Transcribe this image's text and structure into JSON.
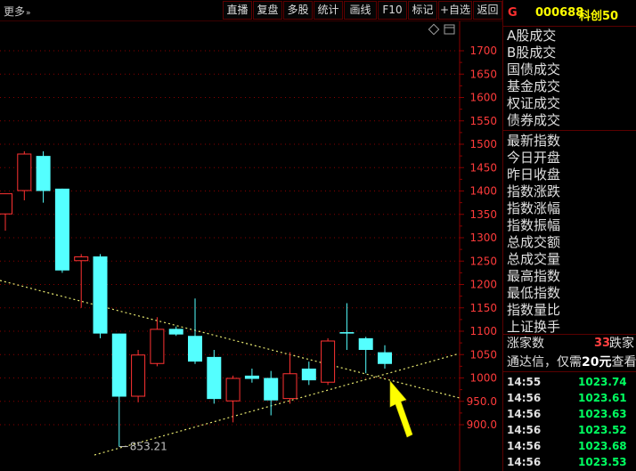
{
  "toolbar": {
    "more_label": "更多",
    "buttons": [
      "直播",
      "复盘",
      "多股",
      "统计",
      "画线",
      "F10",
      "标记",
      "+自选",
      "返回"
    ]
  },
  "chart_data": {
    "type": "candlestick",
    "y_ticks": [
      "1700",
      "1650",
      "1600",
      "1550",
      "1500",
      "1450",
      "1400",
      "1350",
      "1300",
      "1250",
      "1200",
      "1150",
      "1100",
      "1050",
      "1000",
      "950.0",
      "900.0"
    ],
    "ylim": [
      900,
      1700
    ],
    "low_annotation": "853.21",
    "candles": [
      {
        "o": 1350,
        "h": 1390,
        "l": 1315,
        "c": 1395
      },
      {
        "o": 1400,
        "h": 1485,
        "l": 1380,
        "c": 1480
      },
      {
        "o": 1475,
        "h": 1485,
        "l": 1375,
        "c": 1400
      },
      {
        "o": 1405,
        "h": 1405,
        "l": 1225,
        "c": 1230
      },
      {
        "o": 1250,
        "h": 1265,
        "l": 1150,
        "c": 1260
      },
      {
        "o": 1260,
        "h": 1265,
        "l": 1085,
        "c": 1095
      },
      {
        "o": 1095,
        "h": 1095,
        "l": 853.21,
        "c": 960
      },
      {
        "o": 960,
        "h": 1060,
        "l": 948,
        "c": 1050
      },
      {
        "o": 1030,
        "h": 1130,
        "l": 1025,
        "c": 1105
      },
      {
        "o": 1105,
        "h": 1110,
        "l": 1090,
        "c": 1093
      },
      {
        "o": 1090,
        "h": 1170,
        "l": 1030,
        "c": 1035
      },
      {
        "o": 1045,
        "h": 1060,
        "l": 945,
        "c": 955
      },
      {
        "o": 950,
        "h": 1005,
        "l": 905,
        "c": 1000
      },
      {
        "o": 1005,
        "h": 1020,
        "l": 990,
        "c": 998
      },
      {
        "o": 1000,
        "h": 1015,
        "l": 920,
        "c": 952
      },
      {
        "o": 955,
        "h": 1055,
        "l": 945,
        "c": 1010
      },
      {
        "o": 1020,
        "h": 1035,
        "l": 985,
        "c": 995
      },
      {
        "o": 990,
        "h": 1085,
        "l": 985,
        "c": 1080
      },
      {
        "o": 1098,
        "h": 1160,
        "l": 1060,
        "c": 1095
      },
      {
        "o": 1085,
        "h": 1088,
        "l": 1010,
        "c": 1060
      },
      {
        "o": 1055,
        "h": 1070,
        "l": 1020,
        "c": 1030
      }
    ],
    "colors": {
      "up": "#ff3232",
      "down": "#54ffff",
      "trend": "#e8e870",
      "arrow": "#ffff00",
      "grid": "#8a0000"
    }
  },
  "right_panel": {
    "flag": "G",
    "code": "000688",
    "name": "科创50",
    "group1": [
      "A股成交",
      "B股成交",
      "国债成交",
      "基金成交",
      "权证成交",
      "债券成交"
    ],
    "group2": [
      "最新指数",
      "今日开盘",
      "昨日收盘",
      "指数涨跌",
      "指数涨幅",
      "指数振幅",
      "总成交额",
      "总成交量",
      "最高指数",
      "最低指数",
      "指数量比",
      "上证换手"
    ],
    "advancers_label": "涨家数",
    "advancers_count": "33",
    "decliners_label": "跌家",
    "promo_prefix": "通达信，仅需",
    "promo_price": "20元",
    "promo_suffix": "查看",
    "ticks": [
      {
        "time": "14:55",
        "value": "1023.74"
      },
      {
        "time": "14:56",
        "value": "1023.61"
      },
      {
        "time": "14:56",
        "value": "1023.63"
      },
      {
        "time": "14:56",
        "value": "1023.52"
      },
      {
        "time": "14:56",
        "value": "1023.68"
      },
      {
        "time": "14:56",
        "value": "1023.53"
      }
    ]
  }
}
